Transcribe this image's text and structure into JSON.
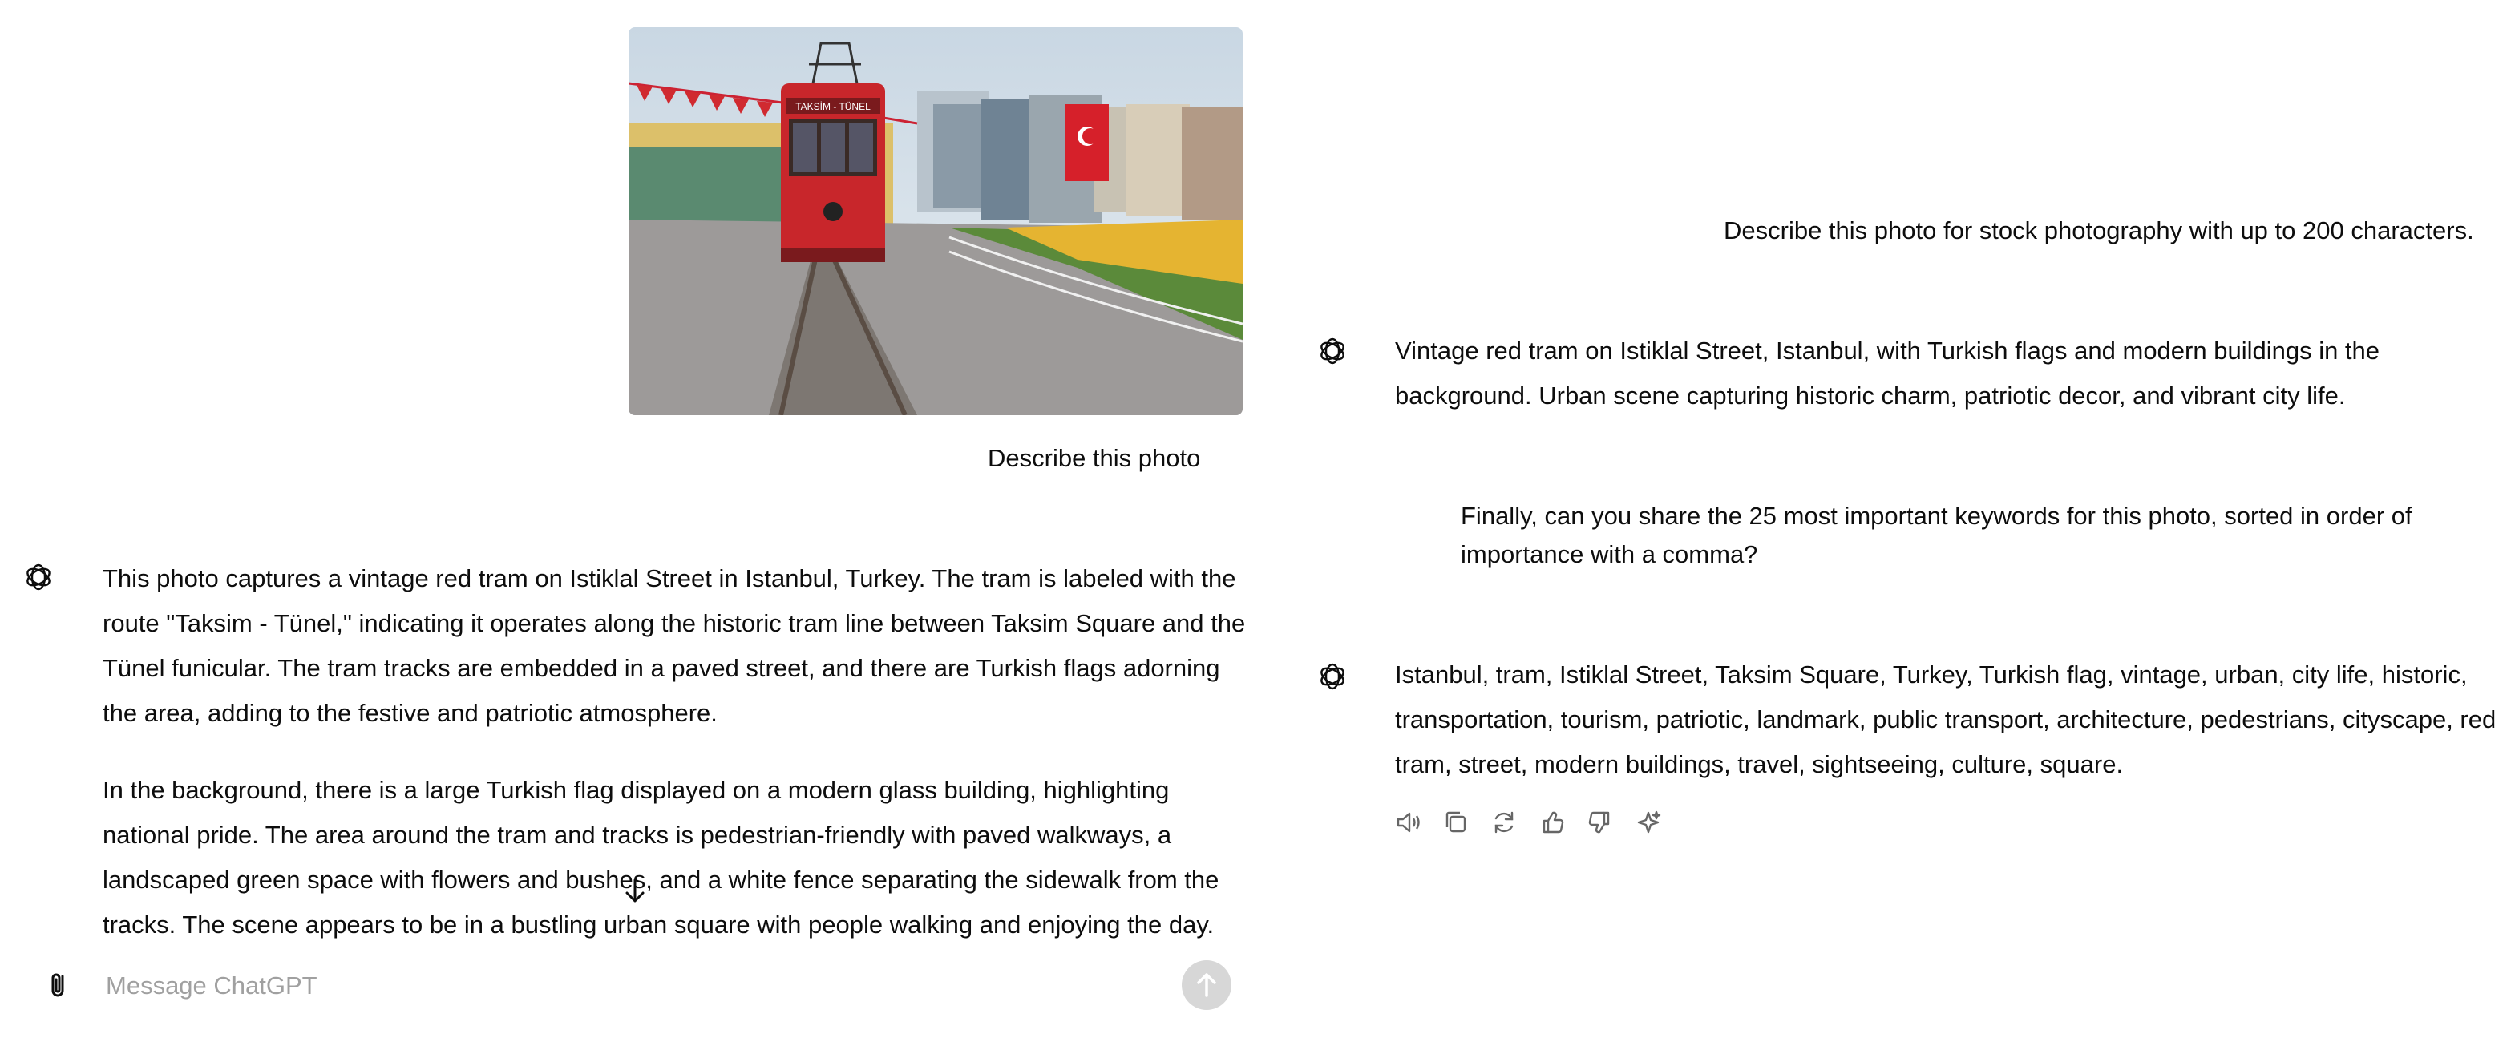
{
  "conversation_left": {
    "image_alt": "",
    "user_message": "Describe this photo",
    "assistant_paragraphs": [
      "This photo captures a vintage red tram on Istiklal Street in Istanbul, Turkey. The tram is labeled with the route \"Taksim - Tünel,\" indicating it operates along the historic tram line between Taksim Square and the Tünel funicular. The tram tracks are embedded in a paved street, and there are Turkish flags adorning the area, adding to the festive and patriotic atmosphere.",
      "In the background, there is a large Turkish flag displayed on a modern glass building, highlighting national pride. The area around the tram and tracks is pedestrian-friendly with paved walkways, a landscaped green space with flowers and bushes, and a white fence separating the sidewalk from the tracks. The scene appears to be in a bustling urban square with people walking and enjoying the day."
    ]
  },
  "photo": {
    "tram_sign": "TAKSİM - TÜNEL"
  },
  "composer": {
    "placeholder": "Message ChatGPT"
  },
  "conversation_right": {
    "user_message_1": "Describe this photo for stock photography with up to 200 characters.",
    "assistant_message_1": "Vintage red tram on Istiklal Street, Istanbul, with Turkish flags and modern buildings in the background. Urban scene capturing historic charm, patriotic decor, and vibrant city life.",
    "user_message_2": "Finally, can you share the 25 most important keywords for this photo, sorted in order of importance with a comma?",
    "assistant_message_2": "Istanbul, tram, Istiklal Street, Taksim Square, Turkey, Turkish flag, vintage, urban, city life, historic, transportation, tourism, patriotic, landmark, public transport, architecture, pedestrians, cityscape, red tram, street, modern buildings, travel, sightseeing, culture, square."
  },
  "actions": [
    "speaker-icon",
    "copy-icon",
    "regenerate-icon",
    "thumbs-up-icon",
    "thumbs-down-icon",
    "sparkle-icon"
  ],
  "colors": {
    "tram_red": "#c8262b",
    "text": "#0d0d0d",
    "muted": "#a0a0a0",
    "send_bg": "#d7d7d7"
  }
}
